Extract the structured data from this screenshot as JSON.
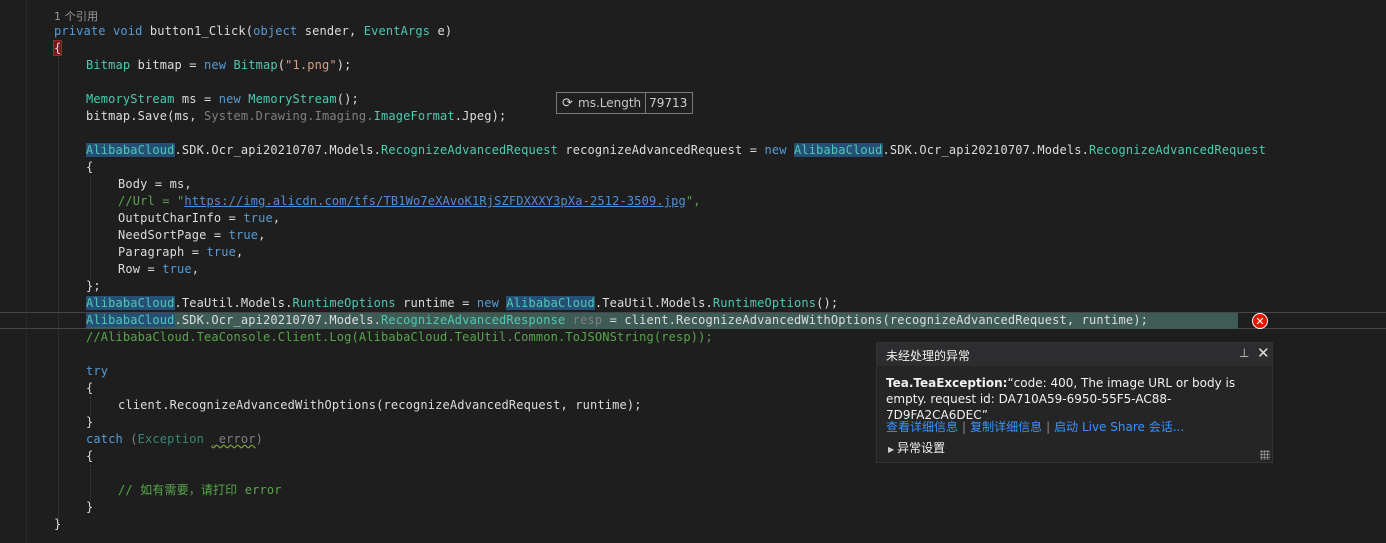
{
  "code": {
    "ref_count": "1 个引用",
    "method_sig": {
      "kw1": "private",
      "kw2": "void",
      "name": "button1_Click",
      "p1_type": "object",
      "p1_name": "sender",
      "p2_type": "EventArgs",
      "p2_name": "e"
    },
    "l_bitmap": {
      "type": "Bitmap",
      "var": "bitmap",
      "kw_new": "new",
      "ctor": "Bitmap",
      "arg": "\"1.png\""
    },
    "l_ms": {
      "type": "MemoryStream",
      "var": "ms",
      "kw_new": "new",
      "ctor": "MemoryStream"
    },
    "l_save": {
      "pre": "bitmap.Save(ms, ",
      "ns": "System.Drawing.Imaging.",
      "type": "ImageFormat",
      "post": ".Jpeg);"
    },
    "l_req": {
      "ns1": "AlibabaCloud",
      "mid1": ".SDK.Ocr_api20210707.Models.",
      "type1": "RecognizeAdvancedRequest",
      "var": " recognizeAdvancedRequest = ",
      "kw_new": "new",
      "ns2": "AlibabaCloud",
      "mid2": ".SDK.Ocr_api20210707.Models.",
      "type2": "RecognizeAdvancedRequest"
    },
    "l_body": "Body = ms,",
    "l_url": {
      "pre": "//Url = \"",
      "link": "https://img.alicdn.com/tfs/TB1Wo7eXAvoK1RjSZFDXXXY3pXa-2512-3509.jpg",
      "post": "\","
    },
    "l_ocr": {
      "name": "OutputCharInfo = ",
      "val": "true",
      "end": ","
    },
    "l_nsp": {
      "name": "NeedSortPage = ",
      "val": "true",
      "end": ","
    },
    "l_par": {
      "name": "Paragraph = ",
      "val": "true",
      "end": ","
    },
    "l_row": {
      "name": "Row = ",
      "val": "true",
      "end": ","
    },
    "l_rt": {
      "ns1": "AlibabaCloud",
      "mid1": ".TeaUtil.Models.",
      "type1": "RuntimeOptions",
      "var": " runtime = ",
      "kw_new": "new",
      "ns2": "AlibabaCloud",
      "mid2": ".TeaUtil.Models.",
      "type2": "RuntimeOptions",
      "post": "();"
    },
    "l_resp": {
      "ns": "AlibabaCloud",
      "mid": ".SDK.Ocr_api20210707.Models.",
      "type": "RecognizeAdvancedResponse",
      "var": "resp",
      "post": " = client.RecognizeAdvancedWithOptions(recognizeAdvancedRequest, runtime);"
    },
    "l_console": "//AlibabaCloud.TeaConsole.Client.Log(AlibabaCloud.TeaUtil.Common.ToJSONString(resp));",
    "l_try": "try",
    "l_call": "client.RecognizeAdvancedWithOptions(recognizeAdvancedRequest, runtime);",
    "l_catch": {
      "kw": "catch",
      "open": " (",
      "type": "Exception",
      "var": "_error",
      "close": ")"
    },
    "l_comment": "// 如有需要，请打印 error"
  },
  "datatip": {
    "name": "ms.Length",
    "value": "79713"
  },
  "exception": {
    "title": "未经处理的异常",
    "exc_type": "Tea.TeaException:",
    "message": "“code: 400, The image URL or body is empty. request id: DA710A59-6950-55F5-AC88-7D9FA2CA6DEC”",
    "link_details": "查看详细信息",
    "link_copy": "复制详细信息",
    "link_share": "启动 Live Share 会话...",
    "settings": "异常设置"
  },
  "colors": {
    "keyword": "#569cd6",
    "type": "#4ec9b0",
    "string": "#d69d85",
    "comment": "#57a64a",
    "exception_highlight": "#3e5c55",
    "error_icon": "#e51400"
  }
}
